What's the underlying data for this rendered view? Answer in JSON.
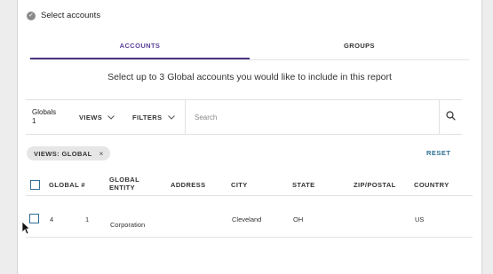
{
  "header": {
    "title": "Select accounts",
    "icon": "check-circle-icon"
  },
  "tabs": [
    {
      "label": "ACCOUNTS",
      "active": true
    },
    {
      "label": "GROUPS",
      "active": false
    }
  ],
  "instruction": "Select up to 3 Global accounts you would like to include in this report",
  "filterbar": {
    "globals_label": "Globals",
    "globals_count": "1",
    "views_label": "VIEWS",
    "filters_label": "FILTERS",
    "search_placeholder": "Search",
    "search_value": ""
  },
  "chip": {
    "label": "VIEWS: GLOBAL",
    "remove": "×"
  },
  "reset_label": "RESET",
  "table": {
    "headers": {
      "global_num": "GLOBAL #",
      "global_entity_1": "GLOBAL",
      "global_entity_2": "ENTITY",
      "address": "ADDRESS",
      "city": "CITY",
      "state": "STATE",
      "zip": "ZIP/POSTAL",
      "country": "COUNTRY"
    },
    "rows": [
      {
        "global_num_a": "4",
        "global_num_b": "1",
        "entity": "Corporation",
        "address": "",
        "city": "Cleveland",
        "state": "OH",
        "zip": "",
        "country": "US"
      }
    ]
  },
  "colors": {
    "accent": "#4d3585",
    "link": "#2f6e93",
    "chip_bg": "#e6e6e6"
  }
}
